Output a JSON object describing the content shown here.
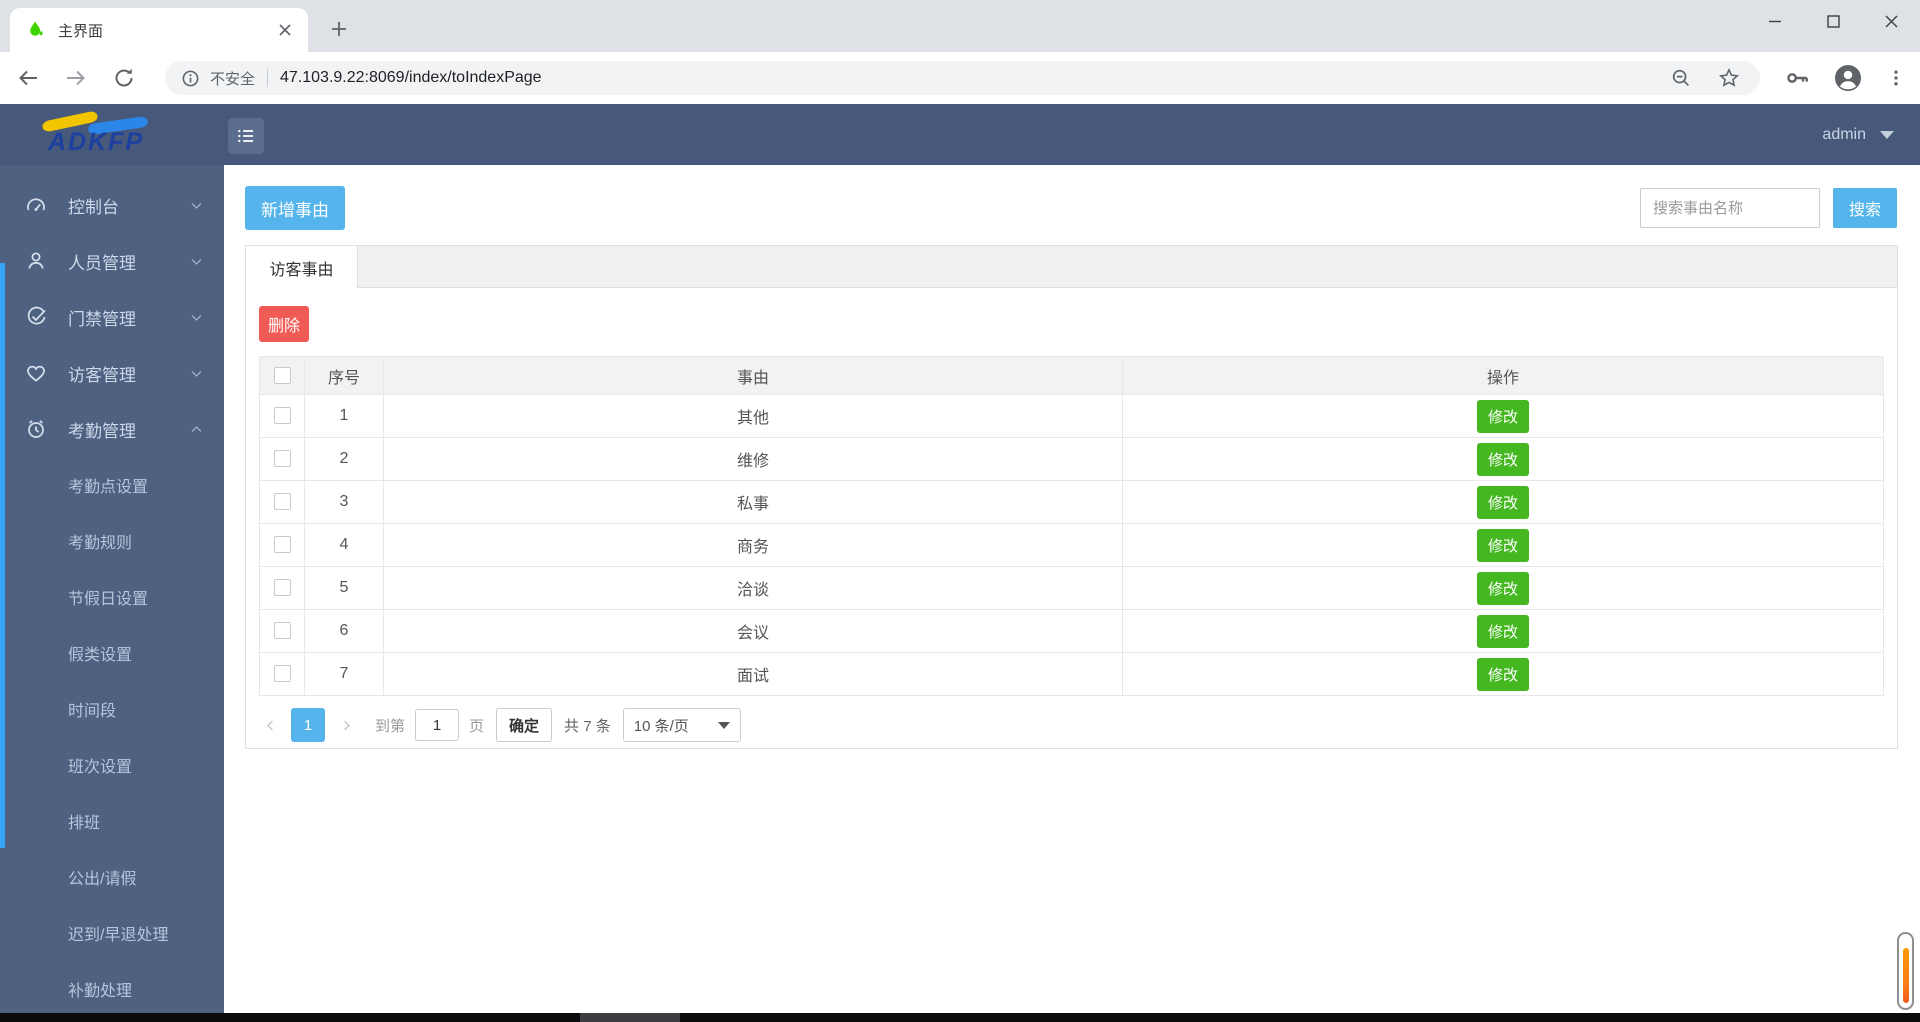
{
  "browser": {
    "tab_title": "主界面",
    "security_label": "不安全",
    "url": "47.103.9.22:8069/index/toIndexPage"
  },
  "app_header": {
    "logo_text": "ADKFP",
    "user": "admin"
  },
  "sidebar": {
    "items": [
      {
        "label": "控制台"
      },
      {
        "label": "人员管理"
      },
      {
        "label": "门禁管理"
      },
      {
        "label": "访客管理"
      },
      {
        "label": "考勤管理"
      }
    ],
    "submenu": [
      "考勤点设置",
      "考勤规则",
      "节假日设置",
      "假类设置",
      "时间段",
      "班次设置",
      "排班",
      "公出/请假",
      "迟到/早退处理",
      "补勤处理"
    ]
  },
  "content": {
    "add_button": "新增事由",
    "search_placeholder": "搜索事由名称",
    "search_button": "搜索",
    "tab": "访客事由",
    "delete_button": "删除"
  },
  "table": {
    "headers": {
      "no": "序号",
      "reason": "事由",
      "action": "操作"
    },
    "modify_label": "修改",
    "rows": [
      {
        "no": "1",
        "reason": "其他"
      },
      {
        "no": "2",
        "reason": "维修"
      },
      {
        "no": "3",
        "reason": "私事"
      },
      {
        "no": "4",
        "reason": "商务"
      },
      {
        "no": "5",
        "reason": "洽谈"
      },
      {
        "no": "6",
        "reason": "会议"
      },
      {
        "no": "7",
        "reason": "面试"
      }
    ]
  },
  "pagination": {
    "current_page": "1",
    "goto_label": "到第",
    "goto_value": "1",
    "page_unit": "页",
    "confirm_button": "确定",
    "total_label": "共 7 条",
    "page_size": "10 条/页"
  },
  "colors": {
    "primary_blue": "#54b4eb",
    "danger_red": "#f05b56",
    "success_green": "#45b821",
    "sidebar_accent": "#36a3f7",
    "header_bg": "#46597b",
    "sidebar_bg": "#4e6181"
  }
}
